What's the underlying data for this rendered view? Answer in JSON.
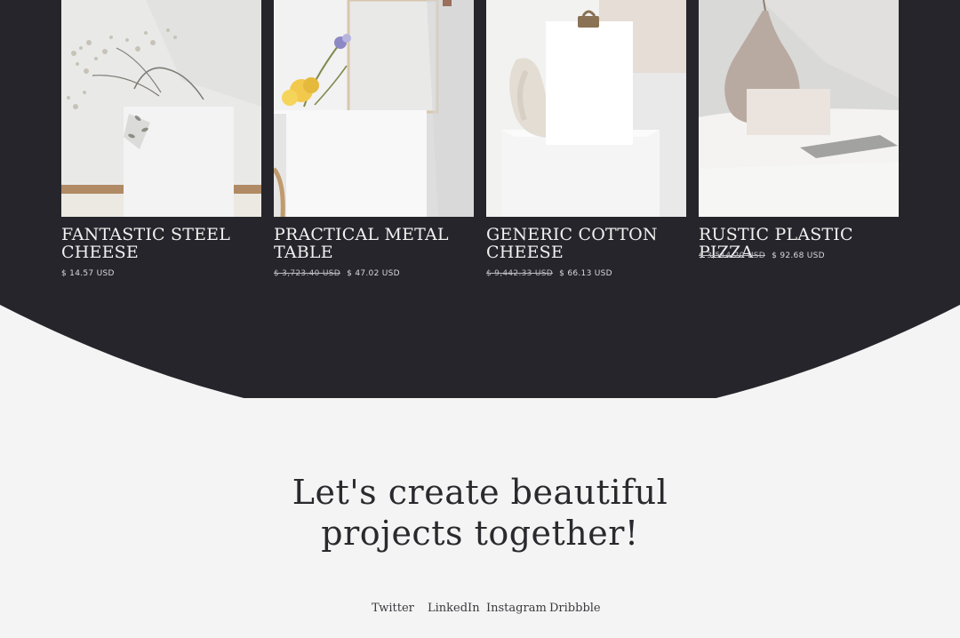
{
  "theme": {
    "dark": "#25252b",
    "light": "#f4f4f4",
    "text_dark": "#2a2a2e",
    "text_light": "#f1f1f1"
  },
  "products": [
    {
      "name": "FANTASTIC STEEL CHEESE",
      "old_price": "",
      "price": "$ 14.57 USD",
      "image_icon": "flower-vase-mockup-icon"
    },
    {
      "name": "PRACTICAL METAL TABLE",
      "old_price": "$ 3,723.40 USD",
      "price": "$ 47.02 USD",
      "image_icon": "flowers-and-frame-mockup-icon"
    },
    {
      "name": "GENERIC COTTON CHEESE",
      "old_price": "$ 9,442.33 USD",
      "price": "$ 66.13 USD",
      "image_icon": "clipboard-paper-mockup-icon"
    },
    {
      "name": "RUSTIC PLASTIC PIZZA",
      "old_price": "$ 3,514.20 USD",
      "price": "$ 92.68 USD",
      "image_icon": "vase-and-card-mockup-icon"
    }
  ],
  "cta": {
    "heading": "Let's create beautiful projects together!"
  },
  "social": [
    {
      "label": "Twitter"
    },
    {
      "label": "LinkedIn"
    },
    {
      "label": "Instagram"
    },
    {
      "label": "Dribbble"
    }
  ]
}
